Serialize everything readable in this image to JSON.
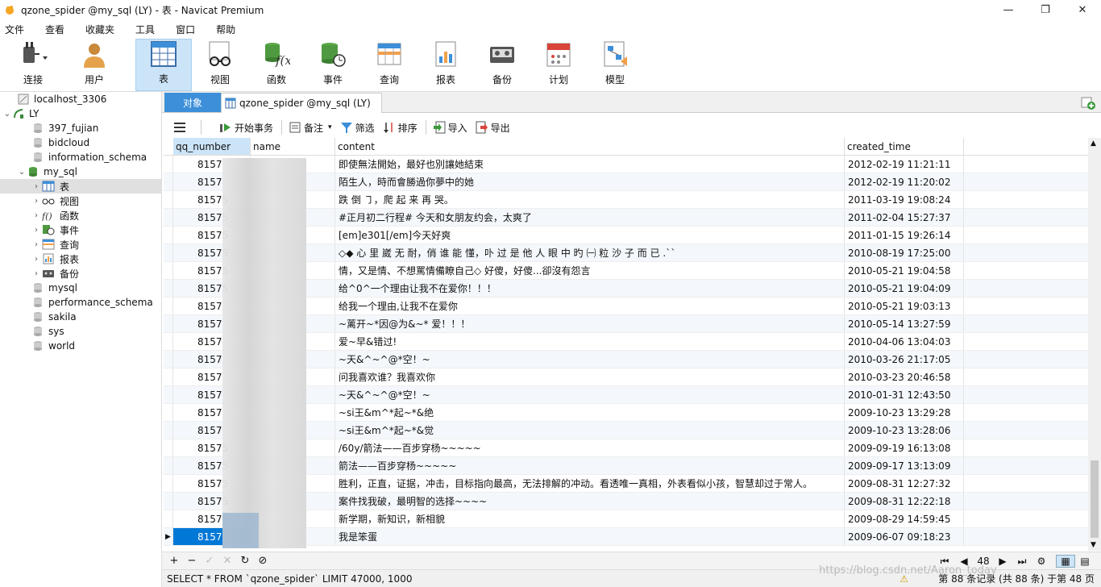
{
  "window": {
    "title": "qzone_spider @my_sql (LY) - 表 - Navicat Premium"
  },
  "menu": [
    "文件",
    "查看",
    "收藏夹",
    "工具",
    "窗口",
    "帮助"
  ],
  "toolbar": [
    {
      "label": "连接",
      "icon": "plug-icon"
    },
    {
      "label": "用户",
      "icon": "user-icon"
    },
    {
      "label": "表",
      "icon": "table-icon",
      "active": true
    },
    {
      "label": "视图",
      "icon": "glasses-icon"
    },
    {
      "label": "函数",
      "icon": "function-icon"
    },
    {
      "label": "事件",
      "icon": "event-clock-icon"
    },
    {
      "label": "查询",
      "icon": "query-icon"
    },
    {
      "label": "报表",
      "icon": "report-icon"
    },
    {
      "label": "备份",
      "icon": "backup-icon"
    },
    {
      "label": "计划",
      "icon": "calendar-icon"
    },
    {
      "label": "模型",
      "icon": "model-icon"
    }
  ],
  "sidebar": {
    "connection": "localhost_3306",
    "server": "LY",
    "databases": [
      "397_fujian",
      "bidcloud",
      "information_schema",
      "my_sql",
      "mysql",
      "performance_schema",
      "sakila",
      "sys",
      "world"
    ],
    "my_sql_children": [
      "表",
      "视图",
      "函数",
      "事件",
      "查询",
      "报表",
      "备份"
    ]
  },
  "tabs": {
    "objects": "对象",
    "current": "qzone_spider @my_sql (LY)"
  },
  "gridtools": {
    "menu": "",
    "begin": "开始事务",
    "memo": "备注",
    "filter": "筛选",
    "sort": "排序",
    "import": "导入",
    "export": "导出"
  },
  "columns": [
    "qq_number",
    "name",
    "content",
    "created_time"
  ],
  "rows": [
    {
      "qq": "8157",
      "content": "即使無法開始，最好也別讓她結束",
      "time": "2012-02-19 11:21:11"
    },
    {
      "qq": "8157",
      "content": "陌生人，時而會勝過你夢中的她",
      "time": "2012-02-19 11:20:02"
    },
    {
      "qq": "81575",
      "content": "跌 倒 ㇆，爬 起 来 再 哭。",
      "time": "2011-03-19 19:08:24"
    },
    {
      "qq": "81575",
      "content": "#正月初二行程# 今天和女朋友约会，太爽了",
      "time": "2011-02-04 15:27:37"
    },
    {
      "qq": "81575",
      "content": "[em]e301[/em]今天好爽",
      "time": "2011-01-15 19:26:14"
    },
    {
      "qq": "81575",
      "content": "◇◆ 心 里 崴 无 耐，俏 谁 能 懂，卟 过 是 他 人 眼 中 旳 ㈠ 粒 沙 子 而 已 .``",
      "time": "2010-08-19 17:25:00"
    },
    {
      "qq": "81575",
      "content": "情，又是情、不想罵情備瞭自己◇ 好傻，好傻...卻沒有怨言",
      "time": "2010-05-21 19:04:58"
    },
    {
      "qq": "81575",
      "content": "给^0^一个理由让我不在爱你！！！",
      "time": "2010-05-21 19:04:09"
    },
    {
      "qq": "8157",
      "content": "给我一个理由,让我不在爱你",
      "time": "2010-05-21 19:03:13"
    },
    {
      "qq": "8157",
      "content": "~蓠开~*因@为&~* 爱！！！",
      "time": "2010-05-14 13:27:59"
    },
    {
      "qq": "8157",
      "content": "爱~早&错过!",
      "time": "2010-04-06 13:04:03"
    },
    {
      "qq": "8157",
      "content": "~天&^~^@*空！~",
      "time": "2010-03-26 21:17:05"
    },
    {
      "qq": "8157",
      "content": "问我喜欢谁？我喜欢你",
      "time": "2010-03-23 20:46:58"
    },
    {
      "qq": "8157",
      "content": "~天&^~^@*空！~",
      "time": "2010-01-31 12:43:50"
    },
    {
      "qq": "8157",
      "content": "~si王&m^*起~*&绝",
      "time": "2009-10-23 13:29:28"
    },
    {
      "qq": "8157",
      "content": "~si王&m^*起~*&觉",
      "time": "2009-10-23 13:28:06"
    },
    {
      "qq": "81575",
      "content": "/60y/箭法——百步穿杨~~~~~",
      "time": "2009-09-19 16:13:08"
    },
    {
      "qq": "81575",
      "content": "箭法——百步穿杨~~~~~",
      "time": "2009-09-17 13:13:09"
    },
    {
      "qq": "81575",
      "content": "胜利，正直，证据，冲击，目标指向最高，无法排解的冲动。看透唯一真相，外表看似小孩，智慧却过于常人。",
      "time": "2009-08-31 12:27:32"
    },
    {
      "qq": "81575",
      "content": "案件找我破，最明智的选择~~~~",
      "time": "2009-08-31 12:22:18"
    },
    {
      "qq": "81575",
      "content": "新学期，新知识，新相貌",
      "time": "2009-08-29 14:59:45"
    },
    {
      "qq": "81575",
      "content": "我是笨蛋",
      "time": "2009-06-07 09:18:23"
    }
  ],
  "pager": {
    "page": "48"
  },
  "status": {
    "sql": "SELECT * FROM `qzone_spider` LIMIT 47000, 1000",
    "records": "第 88 条记录 (共 88 条) 于第 48 页"
  },
  "watermark": "https://blog.csdn.net/Aaron_today",
  "colors": {
    "accent": "#3c8fd8",
    "selected": "#0078d7"
  }
}
